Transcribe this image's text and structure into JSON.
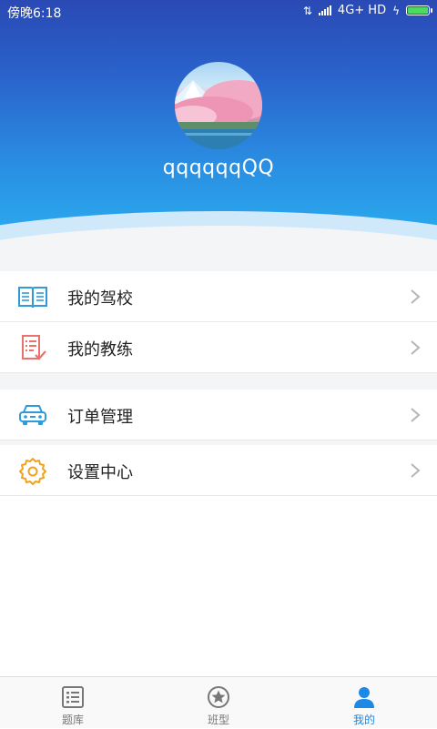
{
  "status_bar": {
    "time": "傍晚6:18",
    "network": "4G+ HD"
  },
  "profile": {
    "username": "qqqqqqQQ",
    "avatar_icon": "avatar-cherry-blossom-photo"
  },
  "menu": {
    "group1": [
      {
        "label": "我的驾校",
        "icon": "open-book-icon",
        "icon_color": "#2f9bd9"
      },
      {
        "label": "我的教练",
        "icon": "checklist-icon",
        "icon_color": "#e8736b"
      }
    ],
    "group2": [
      {
        "label": "订单管理",
        "icon": "car-icon",
        "icon_color": "#2f9bd9"
      },
      {
        "label": "设置中心",
        "icon": "gear-icon",
        "icon_color": "#f0a21a"
      }
    ]
  },
  "tabs": [
    {
      "label": "题库",
      "icon": "question-bank-icon",
      "active": false
    },
    {
      "label": "班型",
      "icon": "star-circle-icon",
      "active": false
    },
    {
      "label": "我的",
      "icon": "person-icon",
      "active": true
    }
  ],
  "colors": {
    "header_top": "#2a49b4",
    "header_bottom": "#2bb0f0",
    "accent": "#1e88e5",
    "section_gap": "#f4f5f7"
  }
}
